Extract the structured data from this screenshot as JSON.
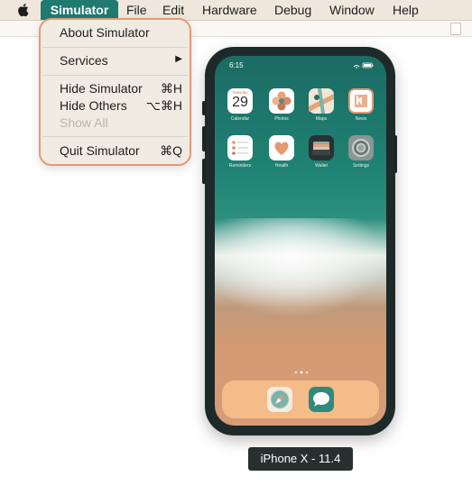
{
  "menubar": {
    "items": [
      "Simulator",
      "File",
      "Edit",
      "Hardware",
      "Debug",
      "Window",
      "Help"
    ],
    "active": "Simulator"
  },
  "dropdown": {
    "about": "About Simulator",
    "services": "Services",
    "hide": "Hide Simulator",
    "hide_shortcut": "⌘H",
    "hide_others": "Hide Others",
    "hide_others_shortcut": "⌥⌘H",
    "show_all": "Show All",
    "quit": "Quit Simulator",
    "quit_shortcut": "⌘Q"
  },
  "phone": {
    "time": "6:15",
    "apps": [
      {
        "label": "Calendar",
        "icon": "calendar-icon",
        "day": "Tuesday",
        "date": "29"
      },
      {
        "label": "Photos",
        "icon": "photos-icon"
      },
      {
        "label": "Maps",
        "icon": "maps-icon"
      },
      {
        "label": "News",
        "icon": "news-icon"
      },
      {
        "label": "Reminders",
        "icon": "reminders-icon"
      },
      {
        "label": "Health",
        "icon": "health-icon"
      },
      {
        "label": "Wallet",
        "icon": "wallet-icon"
      },
      {
        "label": "Settings",
        "icon": "settings-icon"
      }
    ],
    "dock": [
      {
        "icon": "safari-icon"
      },
      {
        "icon": "messages-icon"
      }
    ]
  },
  "device_caption": "iPhone X - 11.4",
  "colors": {
    "accent": "#1f7a70",
    "menu_highlight": "#e39a72",
    "phone_body": "#1e2a29"
  }
}
